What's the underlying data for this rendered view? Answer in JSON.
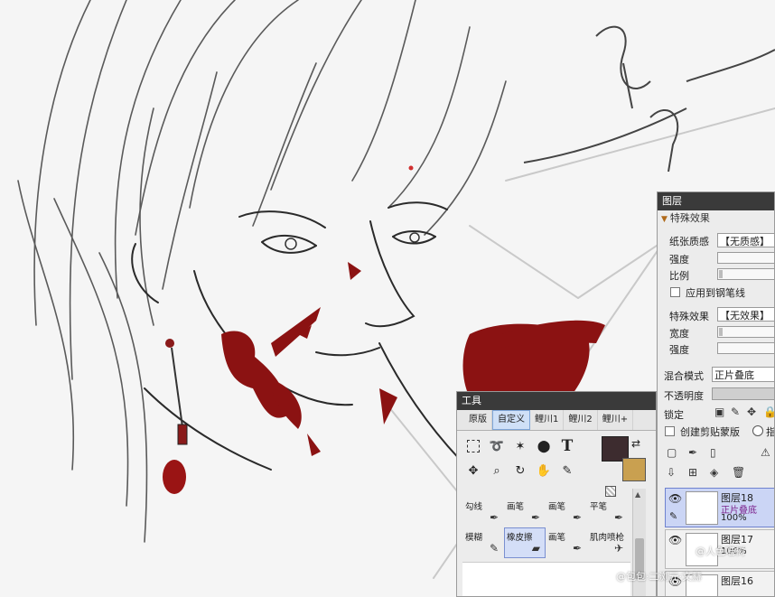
{
  "tools_panel": {
    "title": "工具",
    "tabs": [
      "原版",
      "自定义",
      "鲤川1",
      "鲤川2",
      "鲤川+"
    ],
    "active_tab": 1,
    "brushes_row1": [
      "勾线",
      "画笔",
      "画笔",
      "平笔"
    ],
    "brushes_row2": [
      "模糊",
      "橡皮擦",
      "画笔",
      "肌肉喷枪"
    ],
    "selected_brush": "橡皮擦",
    "colors": {
      "primary": "#3d2c2f",
      "secondary": "#c9a050"
    }
  },
  "layers_panel": {
    "title": "图层",
    "effects_header": "特殊效果",
    "paper_texture_label": "纸张质感",
    "paper_texture_value": "【无质感】",
    "strength_label": "强度",
    "scale_label": "比例",
    "apply_to_lineart_label": "应用到钢笔线",
    "special_effect_label": "特殊效果",
    "special_effect_value": "【无效果】",
    "width_label": "宽度",
    "strength2_label": "强度",
    "blend_mode_label": "混合模式",
    "blend_mode_value": "正片叠底",
    "opacity_label": "不透明度",
    "lock_label": "锁定",
    "clipping_label": "创建剪贴蒙版",
    "radio_label": "指",
    "layers": [
      {
        "name": "图层18",
        "mode": "正片叠底",
        "opacity": "100%",
        "selected": true
      },
      {
        "name": "图层17",
        "mode": "",
        "opacity": "100%",
        "selected": false
      },
      {
        "name": "图层16",
        "mode": "",
        "opacity": "",
        "selected": false
      }
    ]
  },
  "watermarks": {
    "w1": "@人色喵树",
    "w2": "@包包·二浏元·文赫"
  }
}
